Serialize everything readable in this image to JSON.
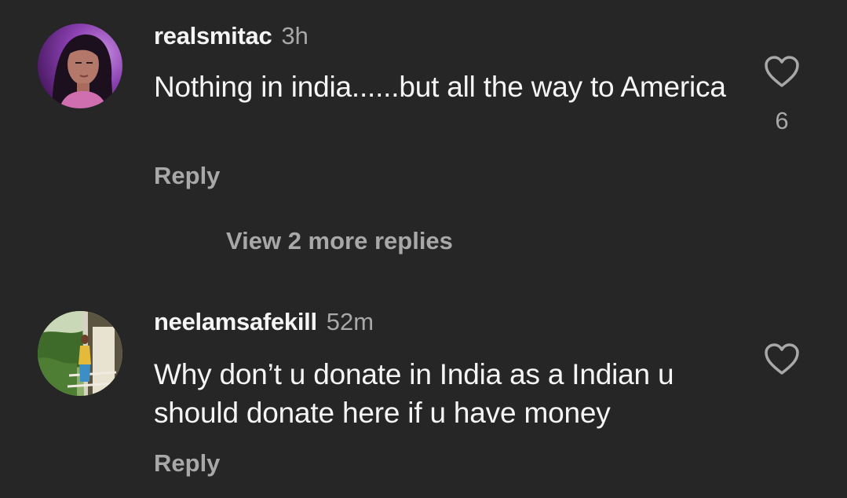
{
  "comments": [
    {
      "username": "realsmitac",
      "time": "3h",
      "text": "Nothing in india......but all the way to America",
      "reply_label": "Reply",
      "like_count": "6",
      "like_icon": "heart-outline-icon"
    },
    {
      "username": "neelamsafekill",
      "time": "52m",
      "text": "Why don’t u donate in India as a Indian u should donate here if u have money",
      "reply_label": "Reply",
      "like_icon": "heart-outline-icon"
    }
  ],
  "view_more_replies": "View 2 more replies",
  "colors": {
    "background": "#262626",
    "primary_text": "#f5f5f5",
    "secondary_text": "#a8a8a8"
  }
}
